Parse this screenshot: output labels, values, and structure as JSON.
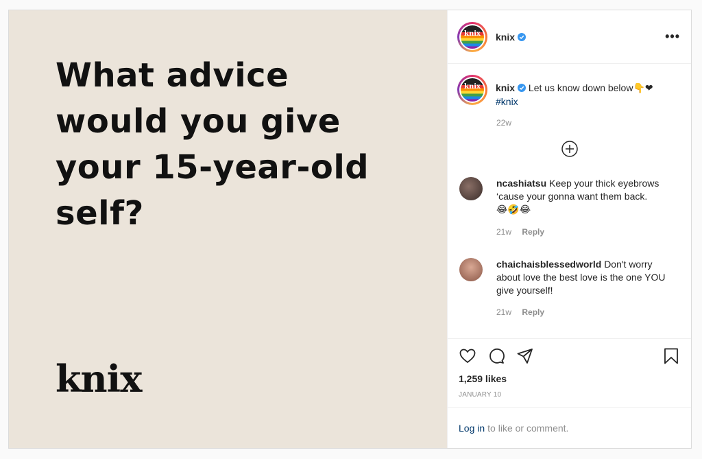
{
  "post": {
    "headline": "What advice would you give your 15-year-old self?",
    "brand_wordmark": "knix"
  },
  "header": {
    "username": "knix",
    "avatar_text": "knix",
    "more_label": "•••"
  },
  "caption": {
    "username": "knix",
    "text": "Let us know down below",
    "emoji": "👇❤",
    "hashtag": "#knix",
    "age": "22w"
  },
  "comments": [
    {
      "username": "ncashiatsu",
      "text": "Keep your thick eyebrows ‘cause your gonna want them back.",
      "emoji": "😂🤣😂",
      "age": "21w",
      "reply_label": "Reply",
      "avatar_color": "#5a4a44"
    },
    {
      "username": "chaichaisblessedworld",
      "text": "Don't worry about love the best love is the one YOU give yourself!",
      "age": "21w",
      "reply_label": "Reply",
      "avatar_color": "#b07a6a"
    }
  ],
  "actions": {
    "likes": "1,259 likes",
    "date": "JANUARY 10",
    "icons": [
      "heart-icon",
      "comment-icon",
      "share-icon",
      "bookmark-icon"
    ]
  },
  "login": {
    "link_label": "Log in",
    "rest_text": "to like or comment."
  },
  "colors": {
    "media_bg": "#ebe4da",
    "link": "#00376b",
    "verified": "#3897f0"
  }
}
